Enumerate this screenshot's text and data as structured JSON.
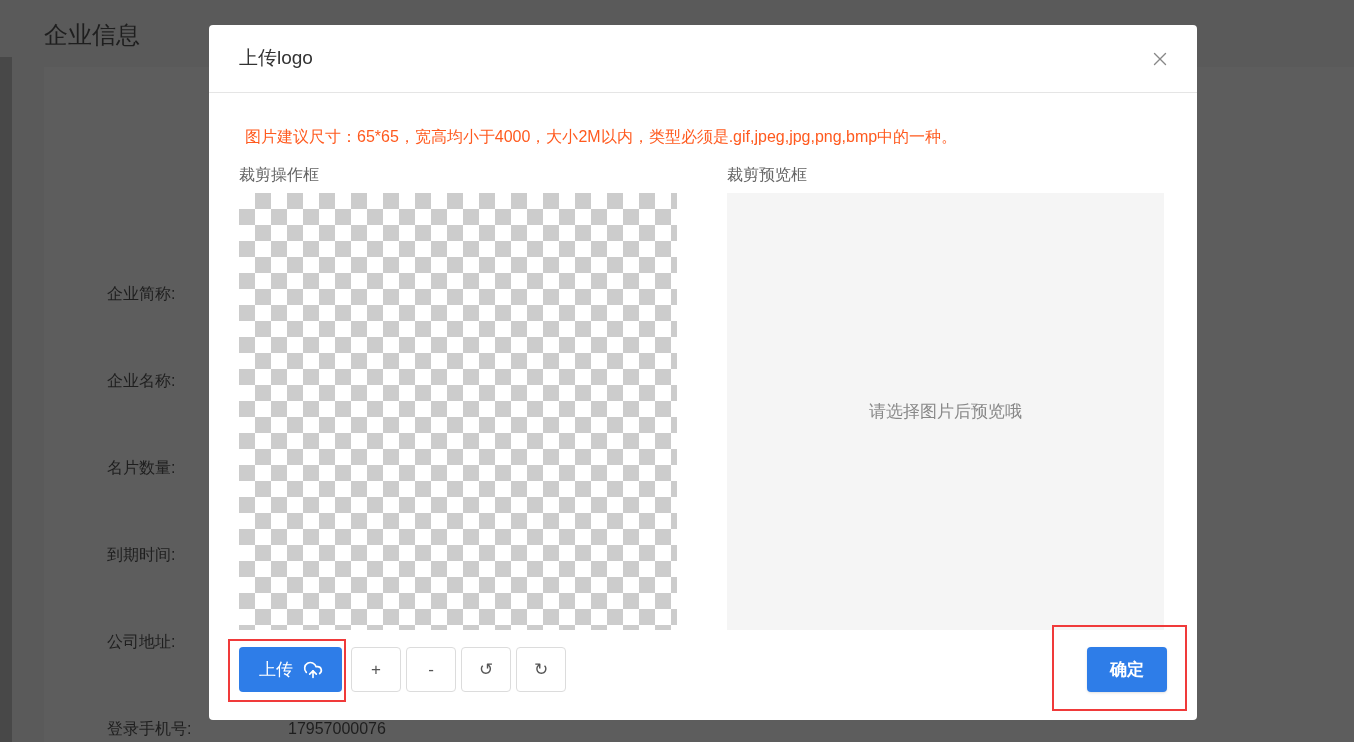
{
  "page": {
    "title": "企业信息",
    "fields": [
      {
        "label": "企业简称:"
      },
      {
        "label": "企业名称:"
      },
      {
        "label": "名片数量:"
      },
      {
        "label": "到期时间:"
      },
      {
        "label": "公司地址:"
      },
      {
        "label": "登录手机号:",
        "value": "17957000076"
      }
    ]
  },
  "modal": {
    "title": "上传logo",
    "notice": "图片建议尺寸：65*65，宽高均小于4000，大小2M以内，类型必须是.gif,jpeg,jpg,png,bmp中的一种。",
    "crop_label": "裁剪操作框",
    "preview_label": "裁剪预览框",
    "preview_placeholder": "请选择图片后预览哦",
    "tools": [
      {
        "kind": "upload",
        "label": "上传"
      },
      {
        "kind": "plain",
        "label": "+"
      },
      {
        "kind": "plain",
        "label": "-"
      },
      {
        "kind": "plain",
        "label": "↺"
      },
      {
        "kind": "plain",
        "label": "↻"
      }
    ],
    "confirm": "确定"
  }
}
